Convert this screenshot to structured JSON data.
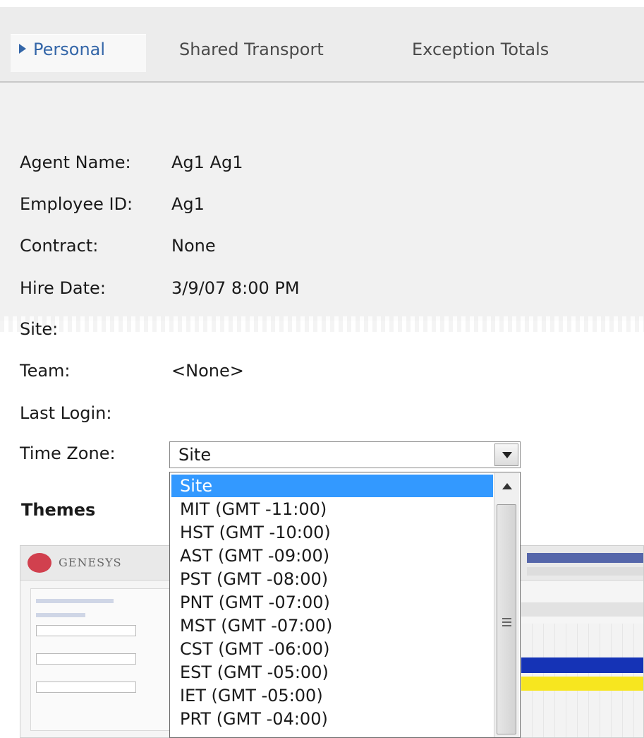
{
  "tabs": [
    {
      "label": "Personal",
      "active": true
    },
    {
      "label": "Shared Transport",
      "active": false
    },
    {
      "label": "Exception Totals",
      "active": false
    }
  ],
  "fields": {
    "agent_name": {
      "label": "Agent Name:",
      "value": "Ag1 Ag1"
    },
    "employee_id": {
      "label": "Employee ID:",
      "value": "Ag1"
    },
    "contract": {
      "label": "Contract:",
      "value": "None"
    },
    "hire_date": {
      "label": "Hire Date:",
      "value": "3/9/07 8:00 PM"
    },
    "site": {
      "label": "Site:",
      "value": ""
    },
    "team": {
      "label": "Team:",
      "value": "<None>"
    },
    "last_login": {
      "label": "Last Login:",
      "value": ""
    },
    "time_zone": {
      "label": "Time Zone:",
      "value": "Site"
    }
  },
  "time_zone_options": [
    "Site",
    "MIT (GMT -11:00)",
    "HST (GMT -10:00)",
    "AST (GMT -09:00)",
    "PST (GMT -08:00)",
    "PNT (GMT -07:00)",
    "MST (GMT -07:00)",
    "CST (GMT -06:00)",
    "EST (GMT -05:00)",
    "IET (GMT -05:00)",
    "PRT (GMT -04:00)"
  ],
  "selected_option_index": 0,
  "themes": {
    "title": "Themes",
    "thumbnail_brand": "GENESYS"
  },
  "colors": {
    "active_tab_text": "#3466a8",
    "selection": "#3399ff"
  }
}
